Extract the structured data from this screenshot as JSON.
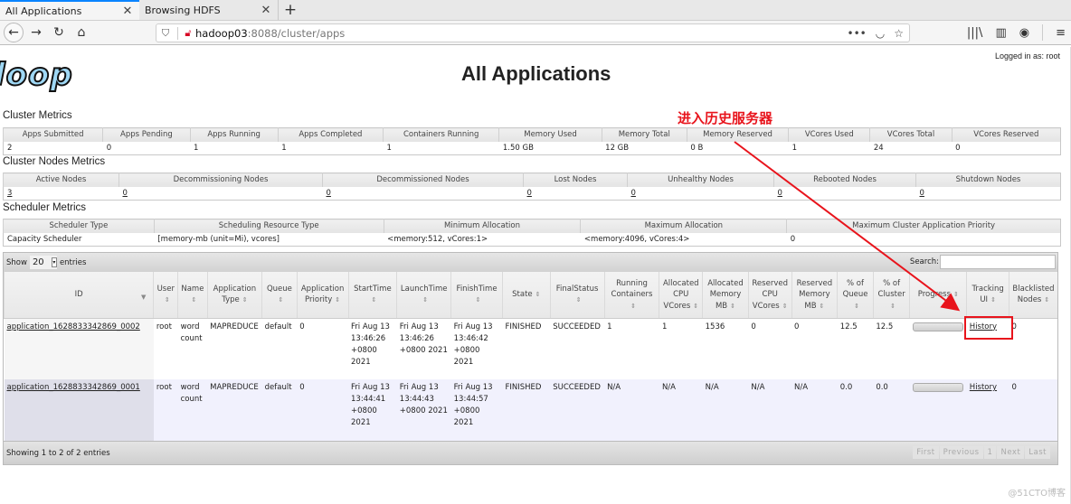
{
  "browser": {
    "tabs": [
      {
        "title": "All Applications",
        "active": true
      },
      {
        "title": "Browsing HDFS",
        "active": false
      }
    ],
    "new_tab": "+",
    "close_glyph": "✕",
    "url_host": "hadoop03",
    "url_path": ":8088/cluster/apps",
    "nav": {
      "back": "←",
      "forward": "→",
      "reload": "↻",
      "home": "⌂"
    },
    "url_actions": {
      "more": "•••",
      "pocket": "◡",
      "bookmark": "☆"
    },
    "toolbar": {
      "library": "|||\\",
      "sidebar": "▥",
      "account": "◉",
      "menu": "≡"
    }
  },
  "page": {
    "logo_text": "loop",
    "title": "All Applications",
    "logged_in": "Logged in as: root"
  },
  "cluster_metrics": {
    "title": "Cluster Metrics",
    "headers": [
      "Apps Submitted",
      "Apps Pending",
      "Apps Running",
      "Apps Completed",
      "Containers Running",
      "Memory Used",
      "Memory Total",
      "Memory Reserved",
      "VCores Used",
      "VCores Total",
      "VCores Reserved"
    ],
    "values": [
      "2",
      "0",
      "1",
      "1",
      "1",
      "1.50 GB",
      "12 GB",
      "0 B",
      "1",
      "24",
      "0"
    ]
  },
  "cluster_nodes_metrics": {
    "title": "Cluster Nodes Metrics",
    "headers": [
      "Active Nodes",
      "Decommissioning Nodes",
      "Decommissioned Nodes",
      "Lost Nodes",
      "Unhealthy Nodes",
      "Rebooted Nodes",
      "Shutdown Nodes"
    ],
    "values": [
      "3",
      "0",
      "0",
      "0",
      "0",
      "0",
      "0"
    ]
  },
  "scheduler_metrics": {
    "title": "Scheduler Metrics",
    "headers": [
      "Scheduler Type",
      "Scheduling Resource Type",
      "Minimum Allocation",
      "Maximum Allocation",
      "Maximum Cluster Application Priority"
    ],
    "values": [
      "Capacity Scheduler",
      "[memory-mb (unit=Mi), vcores]",
      "<memory:512, vCores:1>",
      "<memory:4096, vCores:4>",
      "0"
    ]
  },
  "apps_table": {
    "show_label": "Show",
    "entries_label": "entries",
    "page_length": "20",
    "search_label": "Search:",
    "search_value": "",
    "headers": [
      "ID",
      "User",
      "Name",
      "Application Type",
      "Queue",
      "Application Priority",
      "StartTime",
      "LaunchTime",
      "FinishTime",
      "State",
      "FinalStatus",
      "Running Containers",
      "Allocated CPU VCores",
      "Allocated Memory MB",
      "Reserved CPU VCores",
      "Reserved Memory MB",
      "% of Queue",
      "% of Cluster",
      "Progress",
      "Tracking UI",
      "Blacklisted Nodes"
    ],
    "rows": [
      {
        "id": "application_1628833342869_0002",
        "user": "root",
        "name": "word count",
        "type": "MAPREDUCE",
        "queue": "default",
        "priority": "0",
        "start": "Fri Aug 13 13:46:26 +0800 2021",
        "launch": "Fri Aug 13 13:46:26 +0800 2021",
        "finish": "Fri Aug 13 13:46:42 +0800 2021",
        "state": "FINISHED",
        "final_status": "SUCCEEDED",
        "running_containers": "1",
        "alloc_vcores": "1",
        "alloc_mem": "1536",
        "res_vcores": "0",
        "res_mem": "0",
        "pct_queue": "12.5",
        "pct_cluster": "12.5",
        "progress": 100,
        "tracking": "History",
        "blacklisted": "0"
      },
      {
        "id": "application_1628833342869_0001",
        "user": "root",
        "name": "word count",
        "type": "MAPREDUCE",
        "queue": "default",
        "priority": "0",
        "start": "Fri Aug 13 13:44:41 +0800 2021",
        "launch": "Fri Aug 13 13:44:43 +0800 2021",
        "finish": "Fri Aug 13 13:44:57 +0800 2021",
        "state": "FINISHED",
        "final_status": "SUCCEEDED",
        "running_containers": "N/A",
        "alloc_vcores": "N/A",
        "alloc_mem": "N/A",
        "res_vcores": "N/A",
        "res_mem": "N/A",
        "pct_queue": "0.0",
        "pct_cluster": "0.0",
        "progress": 100,
        "tracking": "History",
        "blacklisted": "0"
      }
    ],
    "info": "Showing 1 to 2 of 2 entries",
    "pager": [
      "First",
      "Previous",
      "1",
      "Next",
      "Last"
    ]
  },
  "annotation": {
    "text": "进入历史服务器",
    "color": "#e8141c"
  },
  "watermark": "@51CTO博客"
}
